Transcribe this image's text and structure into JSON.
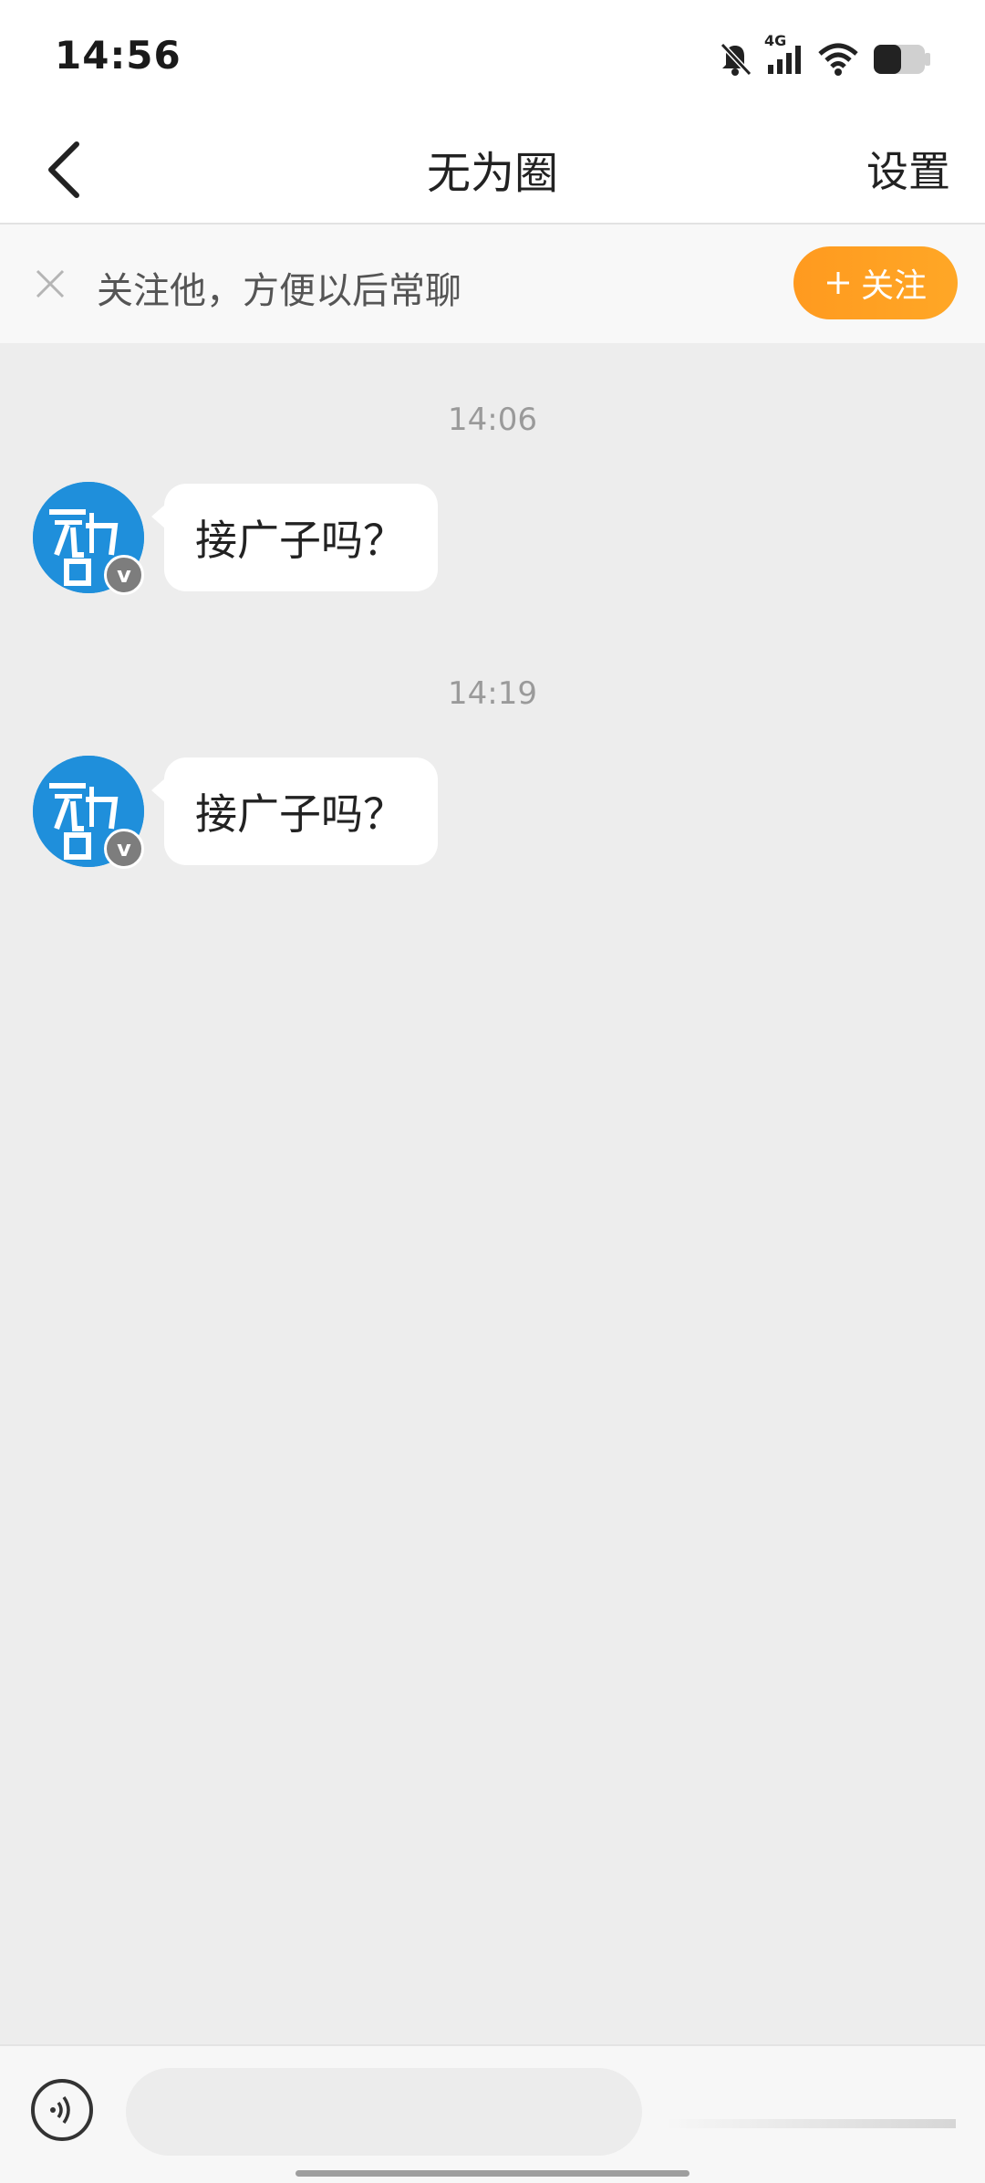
{
  "status_bar": {
    "time": "14:56",
    "network": "4G",
    "icons": [
      "mute-bell-icon",
      "signal-icon",
      "wifi-icon",
      "battery-icon"
    ]
  },
  "header": {
    "back_icon": "chevron-left-icon",
    "title": "无为圈",
    "settings_label": "设置"
  },
  "follow_banner": {
    "close_icon": "close-icon",
    "text": "关注他，方便以后常聊",
    "follow_label": "关注",
    "follow_icon": "plus-icon",
    "accent_color": "#ff9d1f"
  },
  "messages": [
    {
      "timestamp": "14:06",
      "sender_avatar_text": "无为圈",
      "badge": "v",
      "text": "接广子吗？"
    },
    {
      "timestamp": "14:19",
      "sender_avatar_text": "无为圈",
      "badge": "v",
      "text": "接广子吗？"
    }
  ],
  "input_bar": {
    "voice_icon": "voice-icon",
    "placeholder": "",
    "value": ""
  }
}
